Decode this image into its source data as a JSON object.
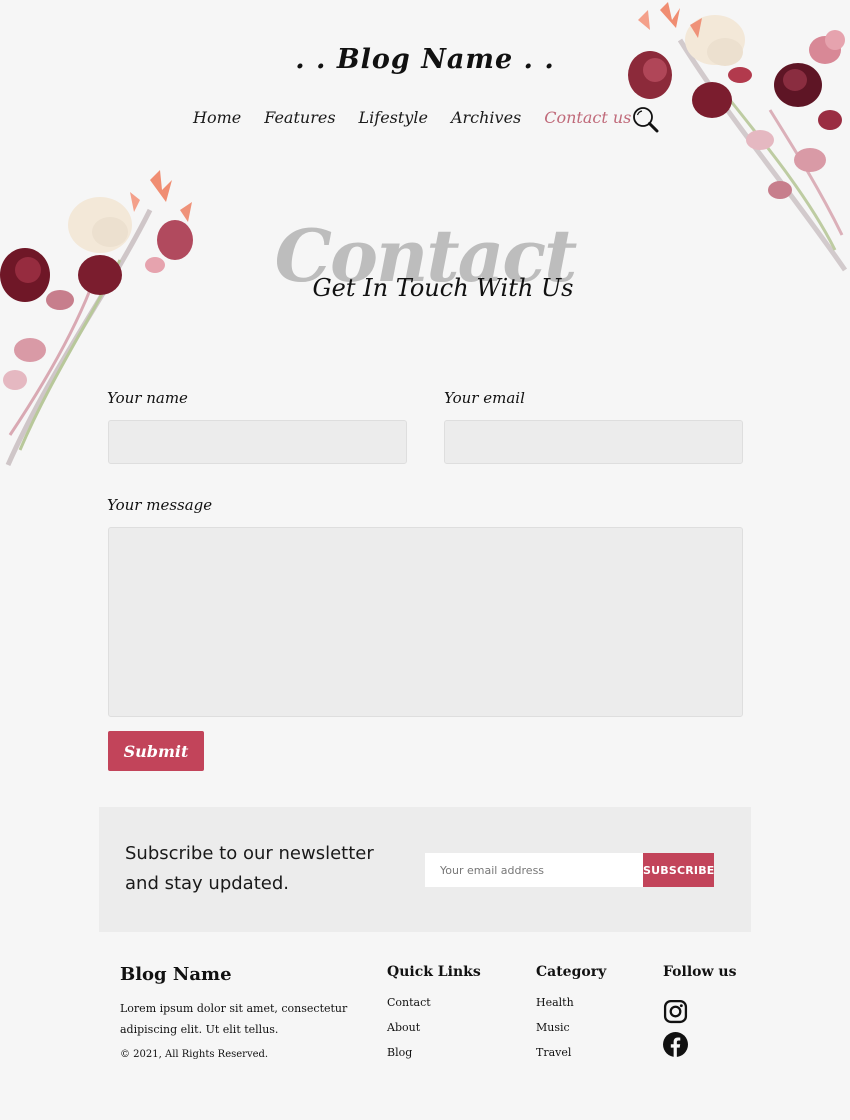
{
  "header": {
    "brand": ". .  Blog Name  . .",
    "nav": [
      "Home",
      "Features",
      "Lifestyle",
      "Archives",
      "Contact us"
    ],
    "active_nav": "Contact us",
    "search_icon": "search-icon"
  },
  "hero": {
    "background_word": "Contact",
    "title": "Get In Touch With Us"
  },
  "form": {
    "name_label": "Your name",
    "name_value": "",
    "email_label": "Your email",
    "email_value": "",
    "message_label": "Your message",
    "message_value": "",
    "submit_label": "Submit"
  },
  "newsletter": {
    "text": "Subscribe to our newsletter and stay updated.",
    "placeholder": "Your email address",
    "button_label": "SUBSCRIBE"
  },
  "footer": {
    "brand": "Blog Name",
    "description": "Lorem ipsum dolor sit amet, consectetur adipiscing elit. Ut elit tellus.",
    "copyright": "© 2021, All Rights Reserved.",
    "quick_links": {
      "heading": "Quick Links",
      "items": [
        "Contact",
        "About",
        "Blog"
      ]
    },
    "category": {
      "heading": "Category",
      "items": [
        "Health",
        "Music",
        "Travel"
      ]
    },
    "follow": {
      "heading": "Follow us",
      "icons": [
        "instagram-icon",
        "facebook-icon"
      ]
    }
  },
  "colors": {
    "accent": "#c2445a",
    "active_link": "#c06a7a",
    "page_background": "#f6f6f6",
    "field_background": "#ececec"
  }
}
